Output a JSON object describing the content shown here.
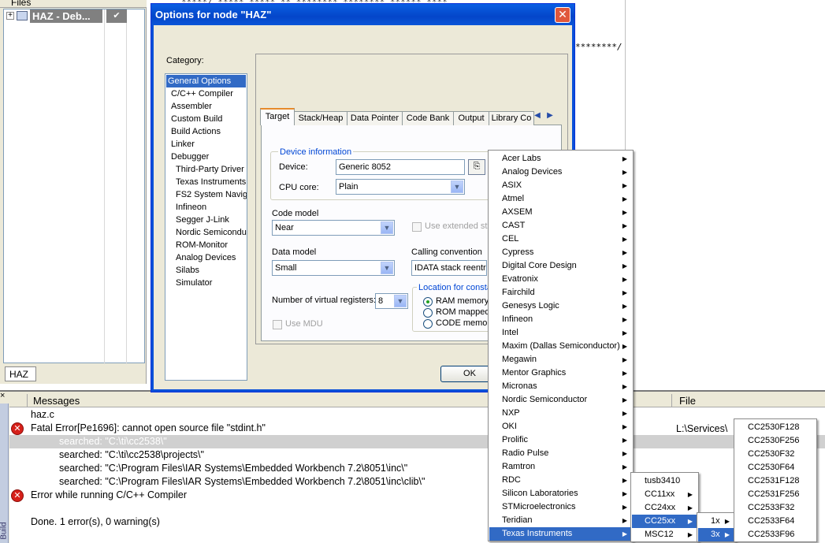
{
  "files_panel": {
    "header": "Files",
    "project_name": "HAZ - Deb...",
    "check_mark": "✔",
    "tab_label": "HAZ"
  },
  "editor": {
    "top_text": "*****/ ***** ***** ** ******** ******** ****** ****",
    "comment_end": "********/"
  },
  "dialog": {
    "title": "Options for node \"HAZ\"",
    "close_glyph": "✕",
    "category_label": "Category:",
    "categories": [
      "General Options",
      "C/C++ Compiler",
      "Assembler",
      "Custom Build",
      "Build Actions",
      "Linker",
      "Debugger",
      "Third-Party Driver",
      "Texas Instruments",
      "FS2 System Navig",
      "Infineon",
      "Segger J-Link",
      "Nordic Semiconduc",
      "ROM-Monitor",
      "Analog Devices",
      "Silabs",
      "Simulator"
    ],
    "tabs": [
      "Target",
      "Stack/Heap",
      "Data Pointer",
      "Code Bank",
      "Output",
      "Library Co"
    ],
    "device_info_label": "Device information",
    "device_label": "Device:",
    "device_value": "Generic 8052",
    "cpu_core_label": "CPU core:",
    "cpu_core_value": "Plain",
    "code_model_label": "Code model",
    "code_model_value": "Near",
    "use_extended_stack_label": "Use extended sta",
    "data_model_label": "Data model",
    "data_model_value": "Small",
    "calling_convention_label": "Calling convention",
    "calling_convention_value": "IDATA stack reentr",
    "virtual_registers_label": "Number of virtual registers:",
    "virtual_registers_value": "8",
    "use_mdu_label": "Use MDU",
    "location_label": "Location for consta",
    "location_options": [
      "RAM memory",
      "ROM mapped",
      "CODE memory"
    ],
    "ok_label": "OK"
  },
  "vendor_menu": {
    "items": [
      "Acer Labs",
      "Analog Devices",
      "ASIX",
      "Atmel",
      "AXSEM",
      "CAST",
      "CEL",
      "Cypress",
      "Digital Core Design",
      "Evatronix",
      "Fairchild",
      "Genesys Logic",
      "Infineon",
      "Intel",
      "Maxim (Dallas Semiconductor)",
      "Megawin",
      "Mentor Graphics",
      "Micronas",
      "Nordic Semiconductor",
      "NXP",
      "OKI",
      "Prolific",
      "Radio Pulse",
      "Ramtron",
      "RDC",
      "Silicon Laboratories",
      "STMicroelectronics",
      "Teridian",
      "Texas Instruments"
    ],
    "highlighted": "Texas Instruments"
  },
  "ti_menu": {
    "items": [
      "tusb3410",
      "CC11xx",
      "CC24xx",
      "CC25xx",
      "MSC12"
    ],
    "highlighted": "CC25xx"
  },
  "cc25_menu": {
    "items": [
      "1x",
      "3x"
    ],
    "highlighted": "3x"
  },
  "cc253x_menu": {
    "items": [
      "CC2530F128",
      "CC2530F256",
      "CC2530F32",
      "CC2530F64",
      "CC2531F128",
      "CC2531F256",
      "CC2533F32",
      "CC2533F64",
      "CC2533F96"
    ]
  },
  "messages": {
    "side_label": "Build",
    "column_messages": "Messages",
    "column_file": "File",
    "close_glyph": "×",
    "rows": [
      {
        "text": "haz.c",
        "error": false,
        "indent": false,
        "selected": false
      },
      {
        "text": "Fatal Error[Pe1696]: cannot open source file \"stdint.h\"",
        "error": true,
        "indent": false,
        "selected": false
      },
      {
        "text": "searched: \"C:\\ti\\cc2538\\\"",
        "error": false,
        "indent": true,
        "selected": true
      },
      {
        "text": "searched: \"C:\\ti\\cc2538\\projects\\\"",
        "error": false,
        "indent": true,
        "selected": false
      },
      {
        "text": "searched: \"C:\\Program Files\\IAR Systems\\Embedded Workbench 7.2\\8051\\inc\\\"",
        "error": false,
        "indent": true,
        "selected": false
      },
      {
        "text": "searched: \"C:\\Program Files\\IAR Systems\\Embedded Workbench 7.2\\8051\\inc\\clib\\\"",
        "error": false,
        "indent": true,
        "selected": false
      },
      {
        "text": "Error while running C/C++ Compiler",
        "error": true,
        "indent": false,
        "selected": false
      },
      {
        "text": "",
        "error": false,
        "indent": false,
        "selected": false
      },
      {
        "text": "Done. 1 error(s), 0 warning(s)",
        "error": false,
        "indent": false,
        "selected": false
      }
    ],
    "file_value": "L:\\Services\\"
  },
  "icons": {
    "expander": "+",
    "error": "✕",
    "submenu": "▶",
    "combo": "▼",
    "device_picker": "⎘",
    "tab_left": "◀",
    "tab_right": "▶"
  }
}
